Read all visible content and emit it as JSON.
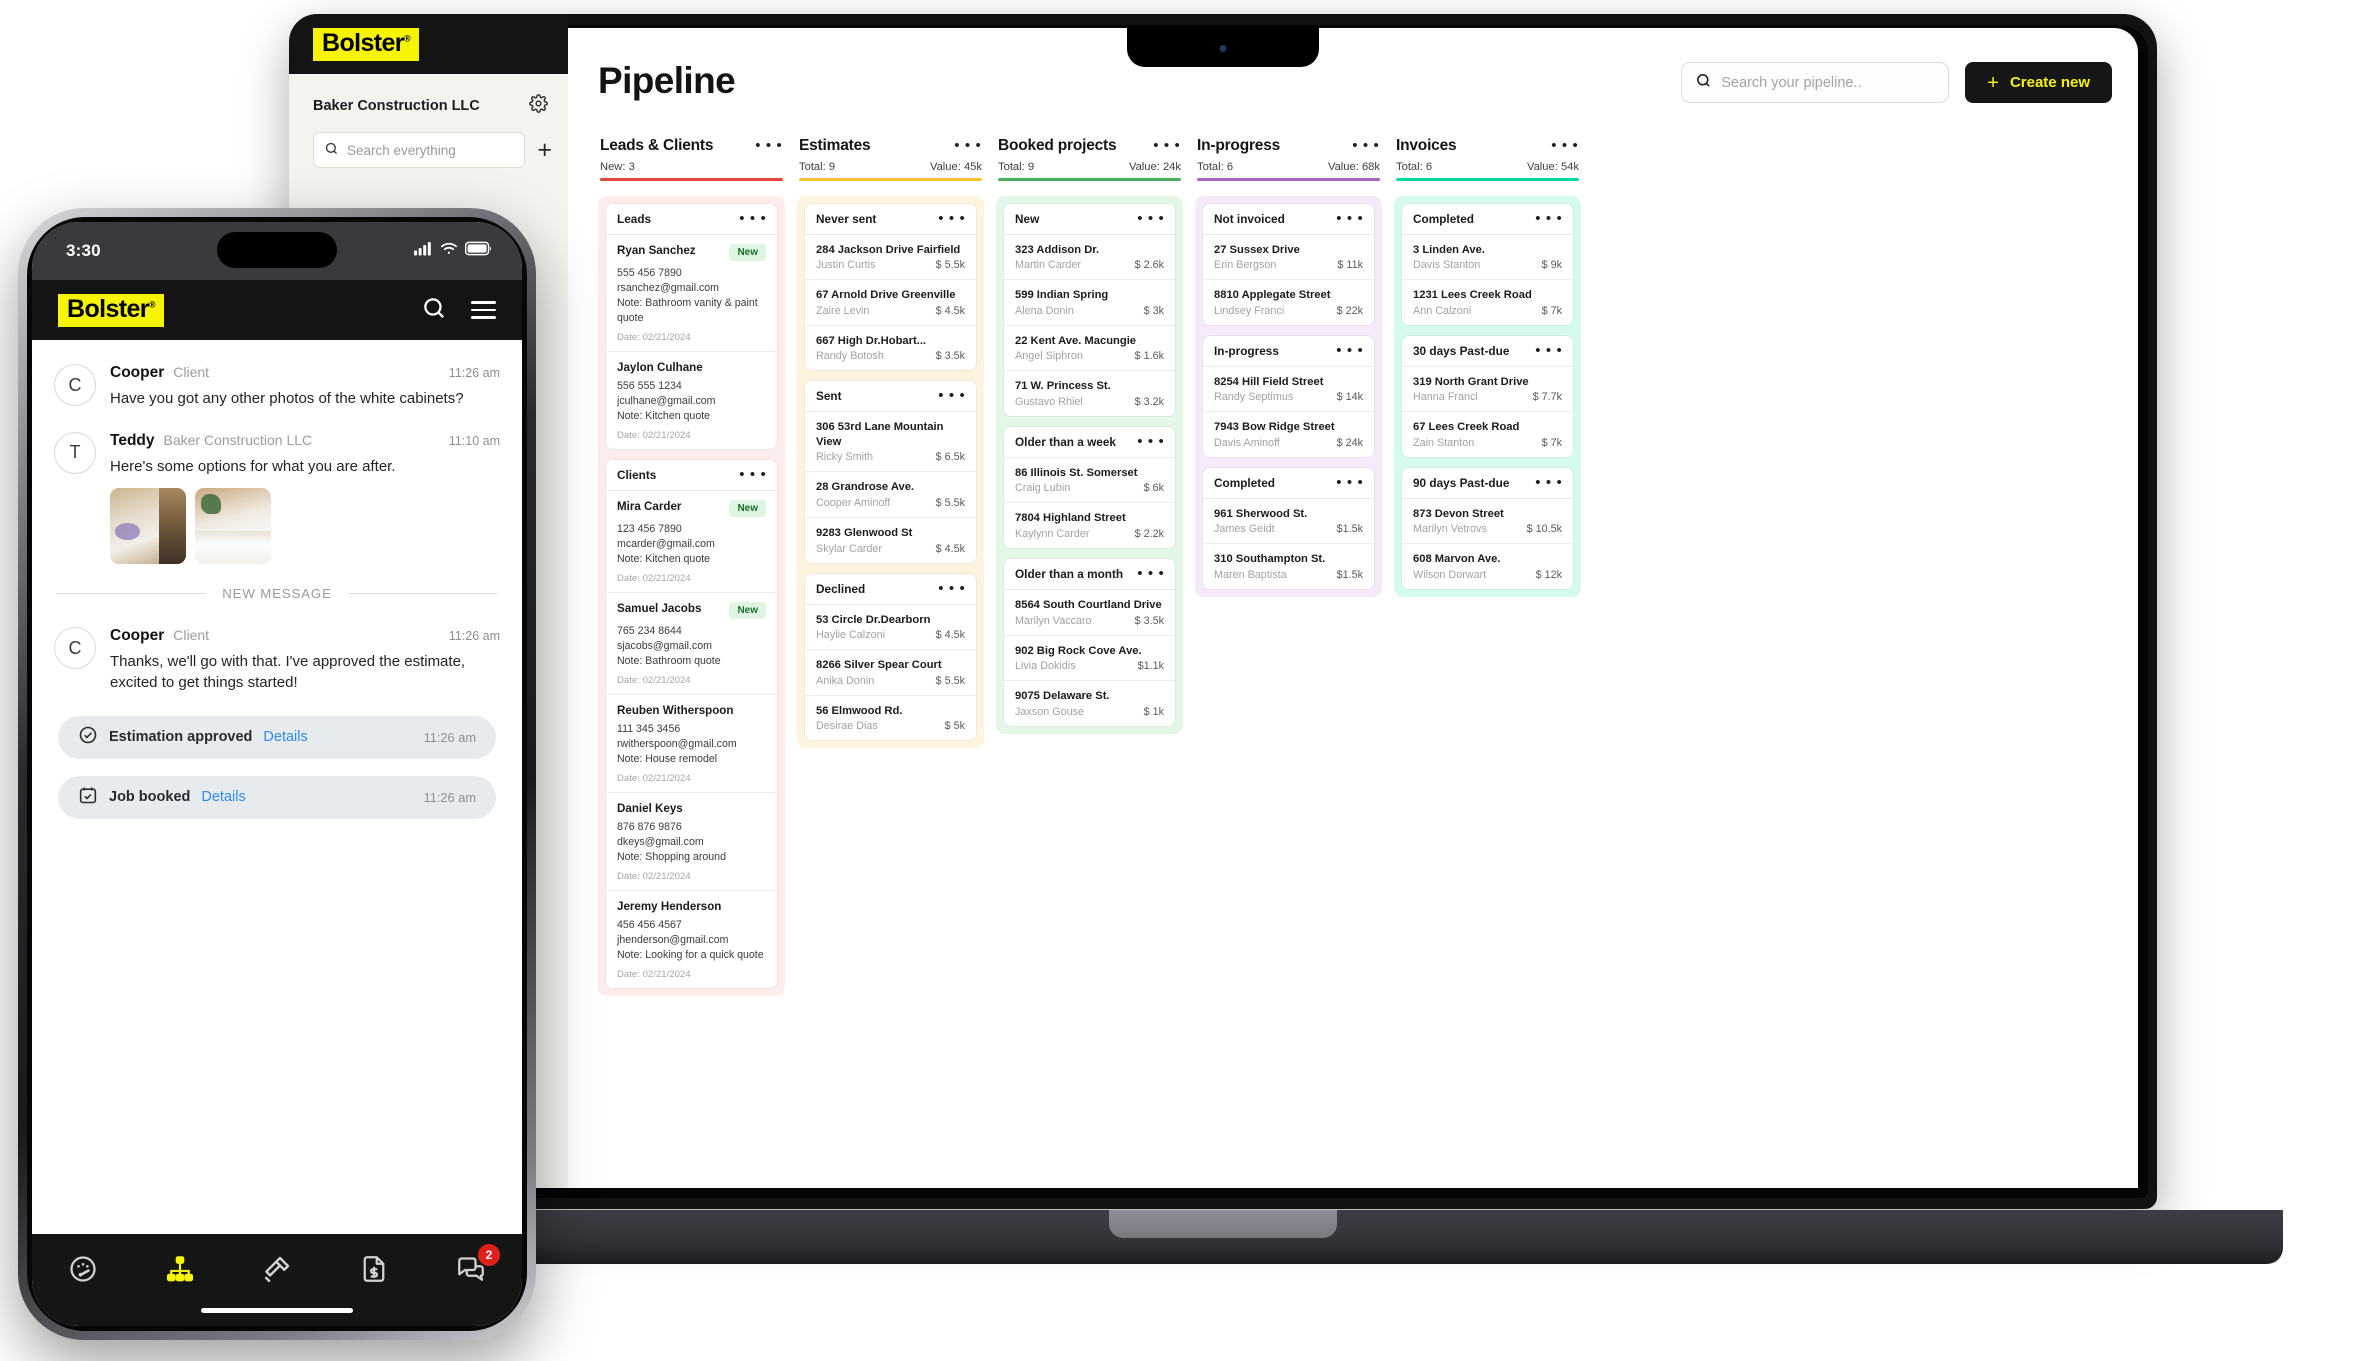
{
  "brand": {
    "logo_text": "Bolster",
    "logo_tm": "®",
    "accent_yellow": "#f7f400"
  },
  "app_sidebar": {
    "org_name": "Baker Construction LLC",
    "settings_icon": "gear-icon",
    "search_placeholder": "Search everything",
    "add_icon": "plus-icon"
  },
  "header": {
    "title": "Pipeline",
    "search_placeholder": "Search your pipeline..",
    "search_icon": "search-icon",
    "create_button": "Create new",
    "create_icon": "plus-icon"
  },
  "columns": [
    {
      "title": "Leads & Clients",
      "meta_left": "New: 3",
      "meta_right": "",
      "accent": "#e8443f",
      "tint": "#fdecec",
      "menu_icon": "more-options-icon",
      "type": "contacts",
      "groups": [
        {
          "title": "Leads",
          "items": [
            {
              "name": "Ryan Sanchez",
              "badge": "New",
              "phone": "555 456 7890",
              "email": "rsanchez@gmail.com",
              "note": "Note: Bathroom vanity & paint quote",
              "date": "Date: 02/21/2024"
            },
            {
              "name": "Jaylon Culhane",
              "badge": "",
              "phone": "556 555 1234",
              "email": "jculhane@gmail.com",
              "note": "Note: Kitchen quote",
              "date": "Date: 02/21/2024"
            }
          ]
        },
        {
          "title": "Clients",
          "items": [
            {
              "name": "Mira Carder",
              "badge": "New",
              "phone": "123 456 7890",
              "email": "mcarder@gmail.com",
              "note": "Note: Kitchen quote",
              "date": "Date: 02/21/2024"
            },
            {
              "name": "Samuel Jacobs",
              "badge": "New",
              "phone": "765 234 8644",
              "email": "sjacobs@gmail.com",
              "note": "Note: Bathroom quote",
              "date": "Date: 02/21/2024"
            },
            {
              "name": "Reuben Witherspoon",
              "badge": "",
              "phone": "111 345 3456",
              "email": "rwitherspoon@gmail.com",
              "note": "Note: House remodel",
              "date": "Date: 02/21/2024"
            },
            {
              "name": "Daniel Keys",
              "badge": "",
              "phone": "876 876 9876",
              "email": "dkeys@gmail.com",
              "note": "Note: Shopping around",
              "date": "Date: 02/21/2024"
            },
            {
              "name": "Jeremy Henderson",
              "badge": "",
              "phone": "456 456 4567",
              "email": "jhenderson@gmail.com",
              "note": "Note: Looking for a quick quote",
              "date": "Date: 02/21/2024"
            }
          ]
        }
      ]
    },
    {
      "title": "Estimates",
      "meta_left": "Total: 9",
      "meta_right": "Value: 45k",
      "accent": "#f5c32c",
      "tint": "#fdf3df",
      "menu_icon": "more-options-icon",
      "type": "jobs",
      "groups": [
        {
          "title": "Never sent",
          "items": [
            {
              "address": "284 Jackson Drive Fairfield",
              "person": "Justin Curtis",
              "amount": "$ 5.5k"
            },
            {
              "address": "67 Arnold Drive Greenville",
              "person": "Zaire Levin",
              "amount": "$ 4.5k"
            },
            {
              "address": "667 High Dr.Hobart...",
              "person": "Randy Botosh",
              "amount": "$ 3.5k"
            }
          ]
        },
        {
          "title": "Sent",
          "items": [
            {
              "address": "306 53rd Lane Mountain View",
              "person": "Ricky Smith",
              "amount": "$ 6.5k"
            },
            {
              "address": "28 Grandrose Ave.",
              "person": "Cooper Aminoff",
              "amount": "$ 5.5k"
            },
            {
              "address": "9283 Glenwood St",
              "person": "Skylar Carder",
              "amount": "$ 4.5k"
            }
          ]
        },
        {
          "title": "Declined",
          "items": [
            {
              "address": "53 Circle Dr.Dearborn",
              "person": "Haylie Calzoni",
              "amount": "$ 4.5k"
            },
            {
              "address": "8266 Silver Spear Court",
              "person": "Anika Donin",
              "amount": "$ 5.5k"
            },
            {
              "address": "56 Elmwood Rd.",
              "person": "Desirae Dias",
              "amount": "$ 5k"
            }
          ]
        }
      ]
    },
    {
      "title": "Booked projects",
      "meta_left": "Total: 9",
      "meta_right": "Value: 24k",
      "accent": "#4caf5e",
      "tint": "#e4f7e6",
      "menu_icon": "more-options-icon",
      "type": "jobs",
      "groups": [
        {
          "title": "New",
          "items": [
            {
              "address": "323 Addison Dr.",
              "person": "Martin Carder",
              "amount": "$ 2.6k"
            },
            {
              "address": "599 Indian Spring",
              "person": "Alena Donin",
              "amount": "$ 3k"
            },
            {
              "address": "22 Kent Ave. Macungie",
              "person": "Angel Siphron",
              "amount": "$ 1.6k"
            },
            {
              "address": "71 W. Princess St.",
              "person": "Gustavo Rhiel",
              "amount": "$ 3.2k"
            }
          ]
        },
        {
          "title": "Older than a week",
          "items": [
            {
              "address": "86 Illinois St. Somerset",
              "person": "Craig Lubin",
              "amount": "$ 6k"
            },
            {
              "address": "7804 Highland Street",
              "person": "Kaylynn Carder",
              "amount": "$ 2.2k"
            }
          ]
        },
        {
          "title": "Older than a month",
          "items": [
            {
              "address": "8564 South Courtland Drive",
              "person": "Marilyn Vaccaro",
              "amount": "$ 3.5k"
            },
            {
              "address": "902 Big Rock Cove Ave.",
              "person": "Livia Dokidis",
              "amount": "$1.1k"
            },
            {
              "address": "9075 Delaware St.",
              "person": "Jaxson Gouse",
              "amount": "$ 1k"
            }
          ]
        }
      ]
    },
    {
      "title": "In-progress",
      "meta_left": "Total: 6",
      "meta_right": "Value: 68k",
      "accent": "#a865c9",
      "tint": "#f5eafa",
      "menu_icon": "more-options-icon",
      "type": "jobs",
      "groups": [
        {
          "title": "Not invoiced",
          "items": [
            {
              "address": "27 Sussex Drive",
              "person": "Erin Bergson",
              "amount": "$ 11k"
            },
            {
              "address": "8810 Applegate Street",
              "person": "Lindsey Franci",
              "amount": "$ 22k"
            }
          ]
        },
        {
          "title": "In-progress",
          "items": [
            {
              "address": "8254 Hill Field Street",
              "person": "Randy Septimus",
              "amount": "$ 14k"
            },
            {
              "address": "7943 Bow Ridge Street",
              "person": "Davis Aminoff",
              "amount": "$ 24k"
            }
          ]
        },
        {
          "title": "Completed",
          "items": [
            {
              "address": "961 Sherwood St.",
              "person": "James Geidt",
              "amount": "$1.5k"
            },
            {
              "address": "310 Southampton St.",
              "person": "Maren Baptista",
              "amount": "$1.5k"
            }
          ]
        }
      ]
    },
    {
      "title": "Invoices",
      "meta_left": "Total: 6",
      "meta_right": "Value: 54k",
      "accent": "#00d9a3",
      "tint": "#d6faf0",
      "menu_icon": "more-options-icon",
      "type": "jobs",
      "groups": [
        {
          "title": "Completed",
          "items": [
            {
              "address": "3 Linden Ave.",
              "person": "Davis Stanton",
              "amount": "$ 9k"
            },
            {
              "address": "1231 Lees Creek Road",
              "person": "Ann Calzoni",
              "amount": "$ 7k"
            }
          ]
        },
        {
          "title": "30 days Past-due",
          "items": [
            {
              "address": "319 North Grant Drive",
              "person": "Hanna Franci",
              "amount": "$ 7.7k"
            },
            {
              "address": "67 Lees Creek Road",
              "person": "Zain Stanton",
              "amount": "$ 7k"
            }
          ]
        },
        {
          "title": "90 days Past-due",
          "items": [
            {
              "address": "873 Devon Street",
              "person": "Marilyn Vetrovs",
              "amount": "$ 10.5k"
            },
            {
              "address": "608 Marvon Ave.",
              "person": "Wilson Dorwart",
              "amount": "$ 12k"
            }
          ]
        }
      ]
    }
  ],
  "phone": {
    "status_bar": {
      "time": "3:30",
      "signal_icon": "cellular-signal-icon",
      "wifi_icon": "wifi-icon",
      "battery_icon": "battery-icon"
    },
    "nav": {
      "search_icon": "search-icon",
      "menu_icon": "hamburger-menu-icon"
    },
    "messages": [
      {
        "initial": "C",
        "name": "Cooper",
        "role": "Client",
        "time": "11:26 am",
        "text": "Have you got any other photos of the white cabinets?",
        "photos": 0
      },
      {
        "initial": "T",
        "name": "Teddy",
        "role": "Baker Construction LLC",
        "time": "11:10 am",
        "text": "Here's some options for what you are after.",
        "photos": 2
      }
    ],
    "new_message_divider": "NEW MESSAGE",
    "messages_after": [
      {
        "initial": "C",
        "name": "Cooper",
        "role": "Client",
        "time": "11:26 am",
        "text": "Thanks, we'll go with that. I've approved the estimate, excited to get things started!"
      }
    ],
    "chips": [
      {
        "icon": "check-circle-icon",
        "label": "Estimation approved",
        "link": "Details",
        "time": "11:26 am"
      },
      {
        "icon": "calendar-check-icon",
        "label": "Job booked",
        "link": "Details",
        "time": "11:26 am"
      }
    ],
    "tabbar": [
      {
        "icon": "dashboard-gauge-icon",
        "active": false,
        "badge": ""
      },
      {
        "icon": "pipeline-hierarchy-icon",
        "active": true,
        "badge": ""
      },
      {
        "icon": "hammer-tools-icon",
        "active": false,
        "badge": ""
      },
      {
        "icon": "invoice-document-icon",
        "active": false,
        "badge": ""
      },
      {
        "icon": "messages-chat-icon",
        "active": false,
        "badge": "2"
      }
    ]
  }
}
